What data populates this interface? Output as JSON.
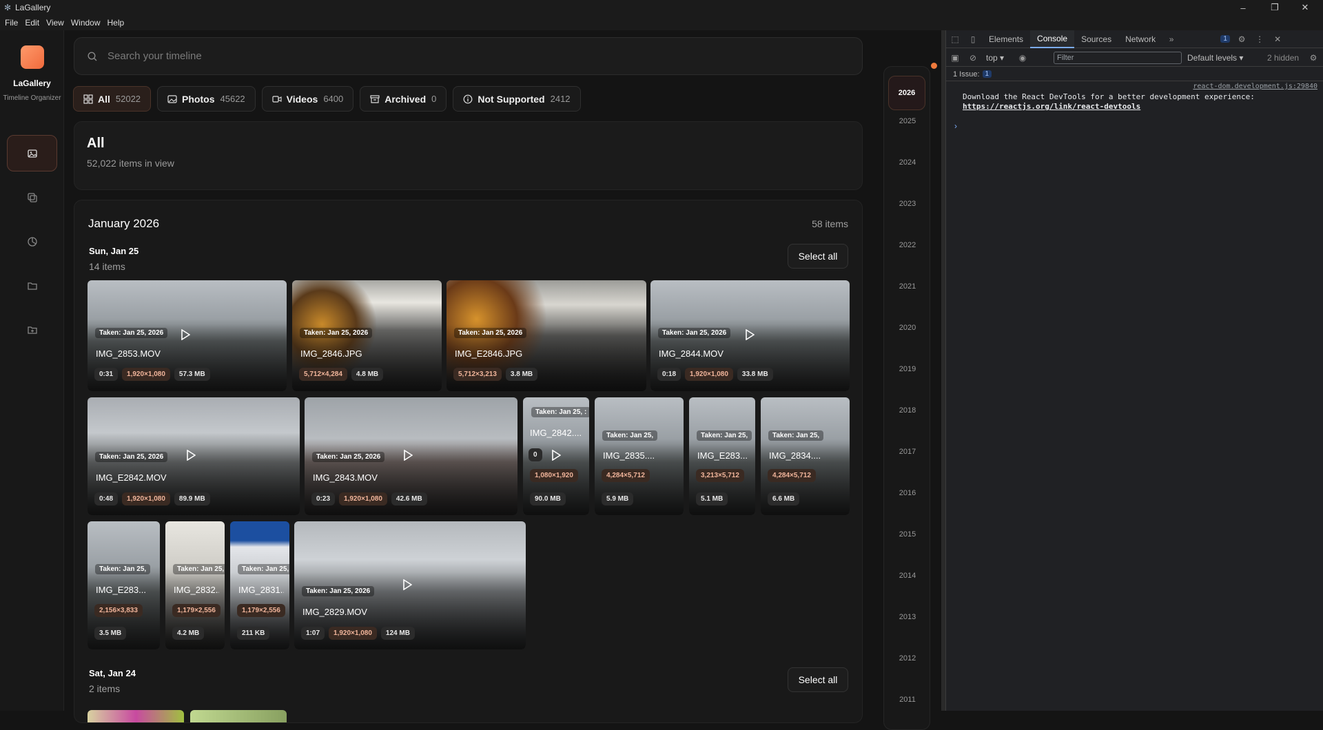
{
  "window": {
    "title": "LaGallery",
    "controls": [
      "–",
      "❐",
      "✕"
    ]
  },
  "menu": [
    "File",
    "Edit",
    "View",
    "Window",
    "Help"
  ],
  "sidebar": {
    "brand": "LaGallery",
    "subtitle": "Timeline Organizer",
    "items": [
      "photos-icon",
      "duplicates-icon",
      "stats-icon",
      "folder-icon",
      "archive-icon"
    ]
  },
  "search": {
    "placeholder": "Search your timeline",
    "value": ""
  },
  "filters": [
    {
      "label": "All",
      "count": "52022",
      "icon": "grid-icon",
      "active": true
    },
    {
      "label": "Photos",
      "count": "45622",
      "icon": "image-icon",
      "active": false
    },
    {
      "label": "Videos",
      "count": "6400",
      "icon": "video-icon",
      "active": false
    },
    {
      "label": "Archived",
      "count": "0",
      "icon": "archive-icon",
      "active": false
    },
    {
      "label": "Not Supported",
      "count": "2412",
      "icon": "info-icon",
      "active": false
    }
  ],
  "view": {
    "title": "All",
    "subtitle": "52,022 items in view"
  },
  "month": {
    "title": "January 2026",
    "count": "58 items"
  },
  "days": [
    {
      "title": "Sun, Jan 25",
      "count": "14 items",
      "select_label": "Select all"
    },
    {
      "title": "Sat, Jan 24",
      "count": "2 items",
      "select_label": "Select all"
    }
  ],
  "tiles": [
    {
      "taken": "Taken: Jan 25, 2026",
      "name": "IMG_2853.MOV",
      "badges": [
        "0:31",
        "1,920×1,080",
        "57.3 MB"
      ],
      "video": true
    },
    {
      "taken": "Taken: Jan 25, 2026",
      "name": "IMG_2846.JPG",
      "badges": [
        "5,712×4,284",
        "4.8 MB"
      ],
      "video": false
    },
    {
      "taken": "Taken: Jan 25, 2026",
      "name": "IMG_E2846.JPG",
      "badges": [
        "5,712×3,213",
        "3.8 MB"
      ],
      "video": false
    },
    {
      "taken": "Taken: Jan 25, 2026",
      "name": "IMG_2844.MOV",
      "badges": [
        "0:18",
        "1,920×1,080",
        "33.8 MB"
      ],
      "video": true
    },
    {
      "taken": "Taken: Jan 25, 2026",
      "name": "IMG_E2842.MOV",
      "badges": [
        "0:48",
        "1,920×1,080",
        "89.9 MB"
      ],
      "video": true
    },
    {
      "taken": "Taken: Jan 25, 2026",
      "name": "IMG_2843.MOV",
      "badges": [
        "0:23",
        "1,920×1,080",
        "42.6 MB"
      ],
      "video": true
    },
    {
      "taken": "Taken: Jan 25, :",
      "name": "IMG_2842....",
      "badges": [
        "1,080×1,920",
        "90.0 MB"
      ],
      "video": true,
      "duration": "0"
    },
    {
      "taken": "Taken: Jan 25,",
      "name": "IMG_2835....",
      "badges": [
        "4,284×5,712",
        "5.9 MB"
      ],
      "video": false
    },
    {
      "taken": "Taken: Jan 25,",
      "name": "IMG_E283...",
      "badges": [
        "3,213×5,712",
        "5.1 MB"
      ],
      "video": false
    },
    {
      "taken": "Taken: Jan 25,",
      "name": "IMG_2834....",
      "badges": [
        "4,284×5,712",
        "6.6 MB"
      ],
      "video": false
    },
    {
      "taken": "Taken: Jan 25,",
      "name": "IMG_E283...",
      "badges": [
        "2,156×3,833",
        "3.5 MB"
      ],
      "video": false
    },
    {
      "taken": "Taken: Jan 25,",
      "name": "IMG_2832....",
      "badges": [
        "1,179×2,556",
        "4.2 MB"
      ],
      "video": false
    },
    {
      "taken": "Taken: Jan 25,",
      "name": "IMG_2831....",
      "badges": [
        "1,179×2,556",
        "211 KB"
      ],
      "video": false
    },
    {
      "taken": "Taken: Jan 25, 2026",
      "name": "IMG_2829.MOV",
      "badges": [
        "1:07",
        "1,920×1,080",
        "124 MB"
      ],
      "video": true
    }
  ],
  "timeline": [
    "2026",
    "2025",
    "2024",
    "2023",
    "2022",
    "2021",
    "2020",
    "2019",
    "2018",
    "2017",
    "2016",
    "2015",
    "2014",
    "2013",
    "2012",
    "2011"
  ],
  "devtools": {
    "tabs": [
      "Elements",
      "Console",
      "Sources",
      "Network"
    ],
    "active_tab": "Console",
    "more": "»",
    "issues_badge": "1",
    "context": "top ▾",
    "filter_placeholder": "Filter",
    "levels": "Default levels ▾",
    "hidden": "2 hidden",
    "issues_text": "1 Issue:",
    "issues_count": "1",
    "source": "react-dom.development.js:29840",
    "message": "Download the React DevTools for a better development experience: ",
    "message_link": "https://reactjs.org/link/react-devtools",
    "prompt": "›"
  },
  "colors": {
    "accent": "#f06a3c",
    "background": "#141414",
    "devtools_bg": "#202124"
  }
}
